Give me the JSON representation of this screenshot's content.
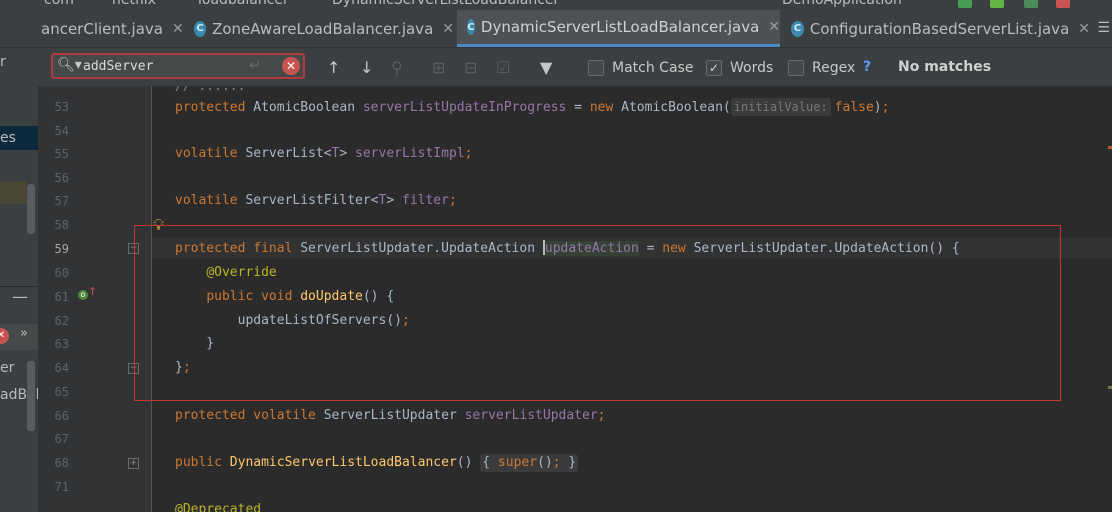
{
  "breadcrumb": {
    "items": [
      "com",
      "netflix",
      "loadbalancer",
      "DynamicServerListLoadBalancer"
    ],
    "run_config": "DemoApplication"
  },
  "tabs": [
    {
      "label": "ancerClient.java",
      "active": false
    },
    {
      "label": "ZoneAwareLoadBalancer.java",
      "active": false
    },
    {
      "label": "DynamicServerListLoadBalancer.java",
      "active": true
    },
    {
      "label": "ConfigurationBasedServerList.java",
      "active": false
    }
  ],
  "tab_menu_glyph": "☰",
  "search": {
    "query": "addServer",
    "match_case_label": "Match Case",
    "match_case_checked": false,
    "words_label": "Words",
    "words_checked": true,
    "regex_label": "Regex",
    "regex_checked": false,
    "regex_help": "?",
    "status": "No matches"
  },
  "project_pane": {
    "fragments": [
      "r",
      "es",
      "er",
      "adBala"
    ]
  },
  "editor": {
    "hint_initial_value": "initialValue:",
    "line_numbers": [
      "53",
      "54",
      "55",
      "56",
      "57",
      "58",
      "59",
      "60",
      "61",
      "62",
      "63",
      "64",
      "65",
      "66",
      "67",
      "68",
      "71"
    ],
    "current_line": "59"
  },
  "colors": {
    "background": "#2b2b2b",
    "keyword": "#cc7832",
    "field": "#9876aa",
    "annotation": "#bbb529",
    "method": "#ffc66d",
    "active_tab_underline": "#4a88c7",
    "search_error_border": "#b33a3a",
    "highlight_box": "#c0392b"
  },
  "icons": [
    "search-icon",
    "enter-icon",
    "clear-icon",
    "previous-occurrence-icon",
    "next-occurrence-icon",
    "find-all-icon",
    "add-occurrence-icon",
    "remove-occurrence-icon",
    "select-all-occurrences-icon",
    "filter-icon",
    "lightbulb-icon",
    "override-method-icon",
    "fold-icon"
  ]
}
